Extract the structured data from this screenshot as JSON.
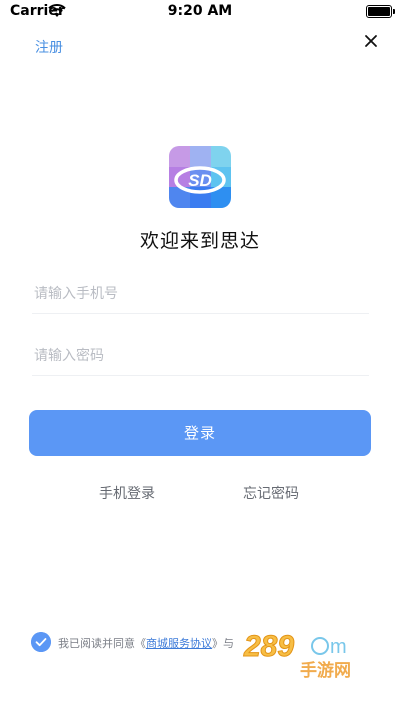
{
  "status_bar": {
    "carrier": "Carrier",
    "time": "9:20 AM"
  },
  "header": {
    "register_label": "注册"
  },
  "welcome_text": "欢迎来到思达",
  "logo": {
    "text": "SD"
  },
  "form": {
    "phone_placeholder": "请输入手机号",
    "password_placeholder": "请输入密码",
    "login_label": "登录"
  },
  "links": {
    "phone_login": "手机登录",
    "forgot_password": "忘记密码"
  },
  "agreement": {
    "prefix": "我已阅读并同意《",
    "service_link": "商城服务协议",
    "suffix": "》与"
  },
  "watermark": {
    "number": "289",
    "site": "手游网"
  },
  "colors": {
    "accent": "#5b97f5",
    "link": "#4a90e2"
  }
}
